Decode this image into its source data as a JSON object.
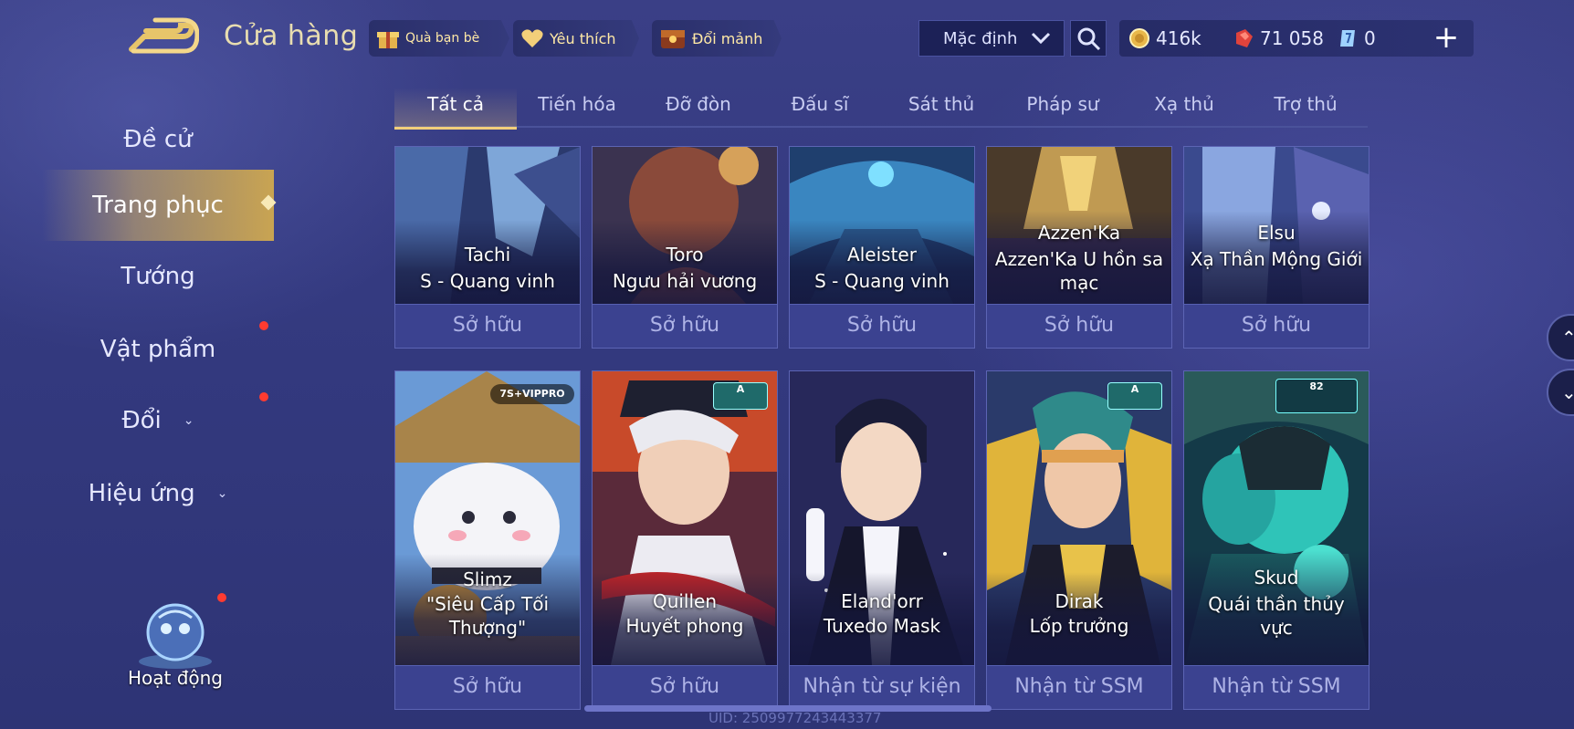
{
  "header": {
    "title": "Cửa hàng",
    "gift_label": "Quà bạn bè",
    "favorites_label": "Yêu thích",
    "exchange_label": "Đổi mảnh",
    "sort_value": "Mặc định",
    "currencies": {
      "gold": "416k",
      "ruby": "71 058",
      "voucher": "0"
    },
    "add_label": "+"
  },
  "sidebar": {
    "items": [
      {
        "label": "Đề cử"
      },
      {
        "label": "Trang phục"
      },
      {
        "label": "Tướng"
      },
      {
        "label": "Vật phẩm"
      },
      {
        "label": "Đổi"
      },
      {
        "label": "Hiệu ứng"
      }
    ],
    "activity_label": "Hoạt động"
  },
  "tabs": [
    "Tất cả",
    "Tiến hóa",
    "Đỡ đòn",
    "Đấu sĩ",
    "Sát thủ",
    "Pháp sư",
    "Xạ thủ",
    "Trợ thủ"
  ],
  "cards_row1": [
    {
      "hero": "Tachi",
      "skin": "S - Quang vinh",
      "status": "Sở hữu"
    },
    {
      "hero": "Toro",
      "skin": "Ngưu hải vương",
      "status": "Sở hữu"
    },
    {
      "hero": "Aleister",
      "skin": "S - Quang vinh",
      "status": "Sở hữu"
    },
    {
      "hero": "Azzen'Ka",
      "skin": "Azzen'Ka U hồn sa mạc",
      "status": "Sở hữu"
    },
    {
      "hero": "Elsu",
      "skin": "Xạ Thần Mộng Giới",
      "status": "Sở hữu"
    }
  ],
  "cards_row2": [
    {
      "hero": "Slimz",
      "skin": "\"Siêu Cấp Tối Thượng\"",
      "status": "Sở hữu",
      "badge": "7S+VIPPRO"
    },
    {
      "hero": "Quillen",
      "skin": "Huyết phong",
      "status": "Sở hữu",
      "badge": "A"
    },
    {
      "hero": "Eland'orr",
      "skin": "Tuxedo Mask",
      "status": "Nhận từ sự kiện"
    },
    {
      "hero": "Dirak",
      "skin": "Lốp trưởng",
      "status": "Nhận từ SSM",
      "badge": "A"
    },
    {
      "hero": "Skud",
      "skin": "Quái thần thủy vực",
      "status": "Nhận từ SSM",
      "badge": "82"
    }
  ],
  "uid_text": "UID: 2509977243443377"
}
